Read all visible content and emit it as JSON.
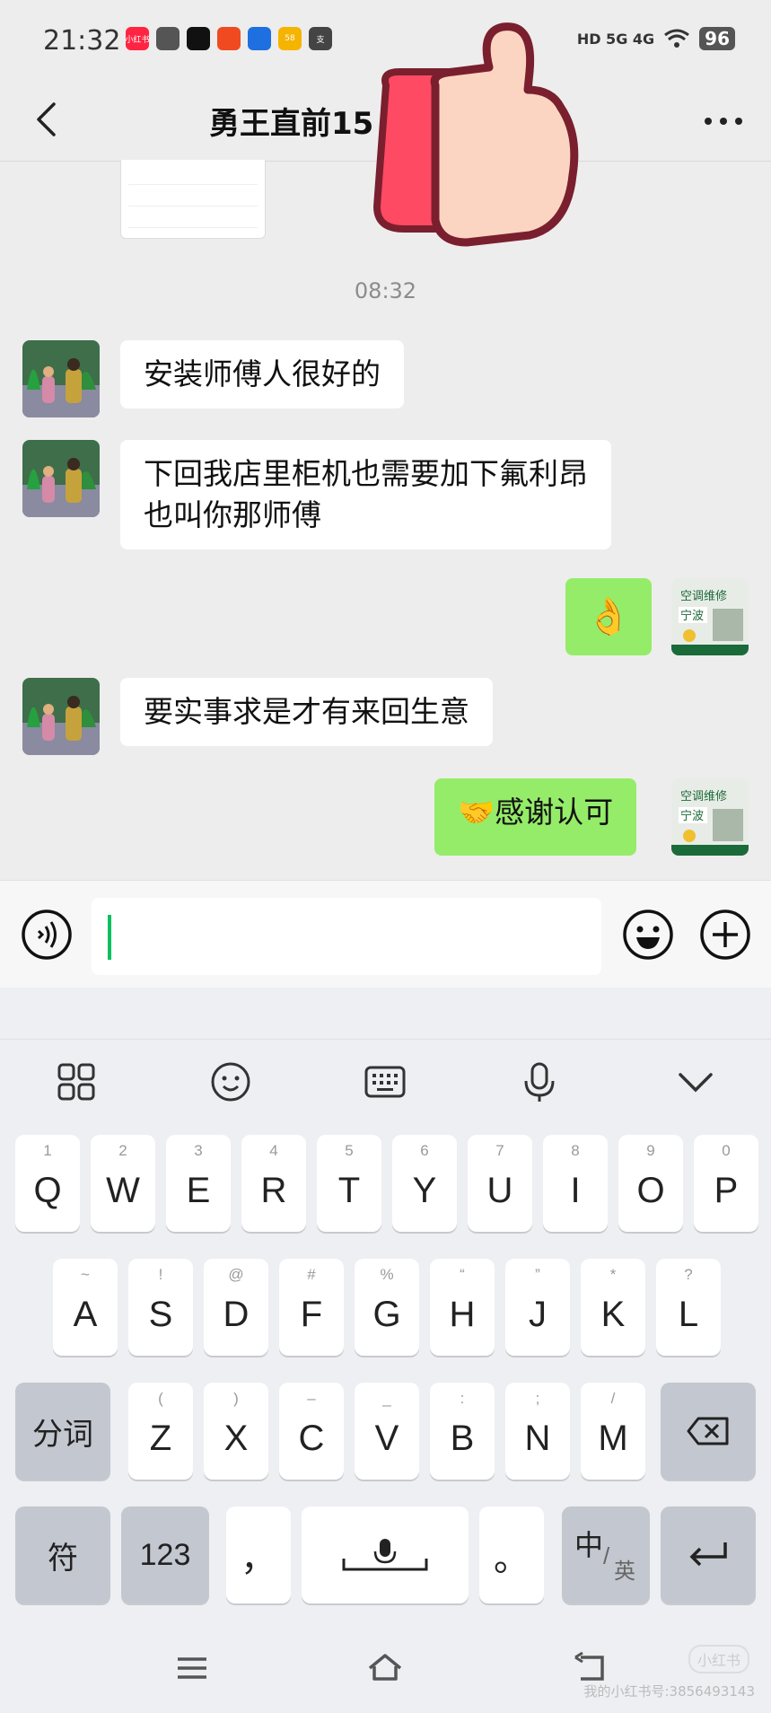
{
  "status_bar": {
    "time": "21:32",
    "apps": [
      {
        "name": "xiaohongshu-app-icon",
        "label": "小红书",
        "color": "#ff2442"
      },
      {
        "name": "wechat-app-icon",
        "label": "",
        "color": "#555555"
      },
      {
        "name": "douyin-app-icon",
        "label": "",
        "color": "#111111"
      },
      {
        "name": "app-icon-4",
        "label": "",
        "color": "#f04a20"
      },
      {
        "name": "app-icon-5",
        "label": "",
        "color": "#1e6fe0"
      },
      {
        "name": "app-icon-58",
        "label": "58",
        "color": "#f5b400"
      },
      {
        "name": "alipay-app-icon",
        "label": "支",
        "color": "#444444"
      }
    ],
    "network": "HD 5G 4G",
    "battery": "96"
  },
  "header": {
    "title": "勇王直前15",
    "back_icon": "chevron-left",
    "more_icon": "ellipsis"
  },
  "chat": {
    "timestamp": "08:32",
    "messages": [
      {
        "direction": "in",
        "text": "安装师傅人很好的"
      },
      {
        "direction": "in",
        "text": "下回我店里柜机也需要加下氟利昂\n也叫你那师傅"
      },
      {
        "direction": "out",
        "text": "👌"
      },
      {
        "direction": "in",
        "text": "要实事求是才有来回生意"
      },
      {
        "direction": "out",
        "text": "🤝感谢认可"
      }
    ],
    "self_avatar": {
      "line1": "空调维修",
      "line2": "宁波"
    }
  },
  "input": {
    "placeholder": ""
  },
  "keyboard": {
    "row1": [
      {
        "sub": "1",
        "main": "Q"
      },
      {
        "sub": "2",
        "main": "W"
      },
      {
        "sub": "3",
        "main": "E"
      },
      {
        "sub": "4",
        "main": "R"
      },
      {
        "sub": "5",
        "main": "T"
      },
      {
        "sub": "6",
        "main": "Y"
      },
      {
        "sub": "7",
        "main": "U"
      },
      {
        "sub": "8",
        "main": "I"
      },
      {
        "sub": "9",
        "main": "O"
      },
      {
        "sub": "0",
        "main": "P"
      }
    ],
    "row2": [
      {
        "sub": "~",
        "main": "A"
      },
      {
        "sub": "!",
        "main": "S"
      },
      {
        "sub": "@",
        "main": "D"
      },
      {
        "sub": "#",
        "main": "F"
      },
      {
        "sub": "%",
        "main": "G"
      },
      {
        "sub": "“",
        "main": "H"
      },
      {
        "sub": "”",
        "main": "J"
      },
      {
        "sub": "*",
        "main": "K"
      },
      {
        "sub": "?",
        "main": "L"
      }
    ],
    "row3": [
      {
        "sub": "(",
        "main": "Z"
      },
      {
        "sub": ")",
        "main": "X"
      },
      {
        "sub": "–",
        "main": "C"
      },
      {
        "sub": "_",
        "main": "V"
      },
      {
        "sub": ":",
        "main": "B"
      },
      {
        "sub": ";",
        "main": "N"
      },
      {
        "sub": "/",
        "main": "M"
      }
    ],
    "segment_label": "分词",
    "symbol_label": "符",
    "numeric_label": "123",
    "comma_label": "，",
    "period_label": "。",
    "lang_zh": "中",
    "lang_en": "英"
  },
  "watermark": {
    "logo": "小红书",
    "text": "我的小红书号:3856493143"
  }
}
